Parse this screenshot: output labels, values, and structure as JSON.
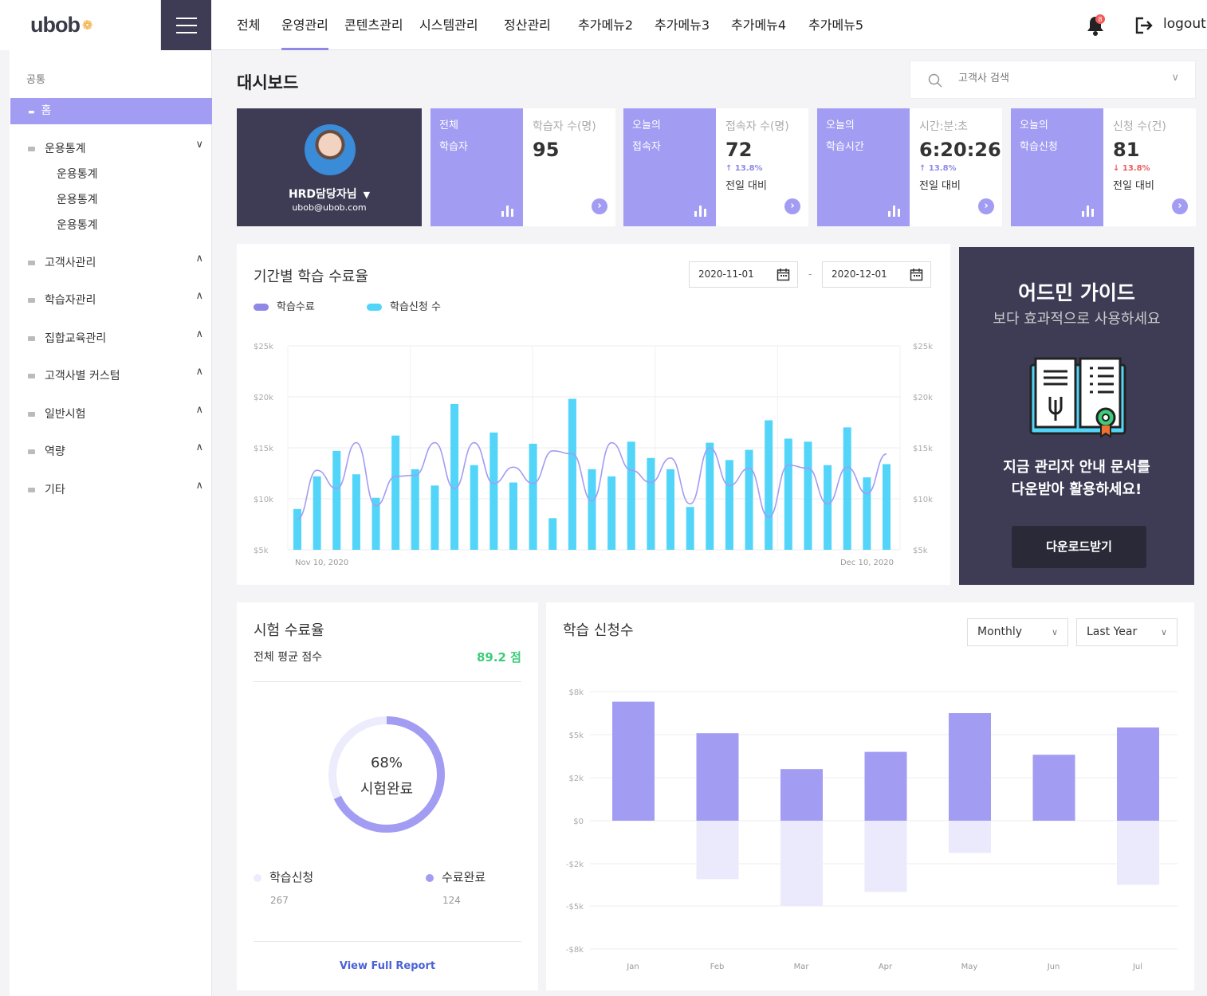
{
  "header": {
    "logo": "ubob",
    "nav": [
      "전체",
      "운영관리",
      "콘텐츠관리",
      "시스템관리",
      "정산관리",
      "추가메뉴2",
      "추가메뉴3",
      "추가메뉴4",
      "추가메뉴5"
    ],
    "active_nav": "운영관리",
    "notification_count": "8",
    "logout": "logout"
  },
  "sidebar": {
    "caption": "공통",
    "home": "홈",
    "items": [
      "운용통계",
      "고객사관리",
      "학습자관리",
      "집합교육관리",
      "고객사별 커스텀",
      "일반시험",
      "역량",
      "기타"
    ],
    "subitems": [
      "운용통계",
      "운용통계",
      "운용통계"
    ]
  },
  "page": {
    "title": "대시보드",
    "search_placeholder": "고객사 검색"
  },
  "profile": {
    "name": "HRD담당자님",
    "email": "ubob@ubob.com"
  },
  "stats": [
    {
      "line1": "전체",
      "line2": "학습자",
      "caption": "학습자 수(명)",
      "value": "95",
      "delta": "",
      "compare": ""
    },
    {
      "line1": "오늘의",
      "line2": "접속자",
      "caption": "접속자 수(명)",
      "value": "72",
      "delta": "↑ 13.8%",
      "compare": "전일 대비",
      "direction": "up"
    },
    {
      "line1": "오늘의",
      "line2": "학습시간",
      "caption": "시간:분:초",
      "value": "6:20:26",
      "delta": "↑ 13.8%",
      "compare": "전일 대비",
      "direction": "up"
    },
    {
      "line1": "오늘의",
      "line2": "학습신청",
      "caption": "신청 수(건)",
      "value": "81",
      "delta": "↓ 13.8%",
      "compare": "전일 대비",
      "direction": "down"
    }
  ],
  "line_chart": {
    "title": "기간별 학습 수료율",
    "date_from": "2020-11-01",
    "date_to": "2020-12-01",
    "date_sep": "-",
    "legend": [
      "학습수료",
      "학습신청 수"
    ]
  },
  "guide": {
    "title": "어드민 가이드",
    "subtitle": "보다 효과적으로 사용하세요",
    "text_line1": "지금 관리자 안내 문서를",
    "text_line2": "다운받아 활용하세요!",
    "button": "다운로드받기"
  },
  "exam": {
    "title": "시험 수료율",
    "avg_label": "전체 평균 점수",
    "avg_value": "89.2 점",
    "percent": "68%",
    "percent_label": "시험완료",
    "percent_value": 0.68,
    "legend": [
      {
        "label": "학습신청",
        "value": "267"
      },
      {
        "label": "수료완료",
        "value": "124"
      }
    ],
    "report_link": "View Full Report"
  },
  "bar_panel": {
    "title": "학습 신청수",
    "period": "Monthly",
    "range": "Last Year"
  },
  "colors": {
    "accent": "#a29cf3",
    "dark": "#3e3c55",
    "cyan": "#52d5f8",
    "green": "#3dcc7a",
    "up": "#8f88e6",
    "down": "#f05a5a"
  },
  "chart_data": [
    {
      "type": "bar",
      "title": "기간별 학습 수료율",
      "x_start_label": "Nov 10, 2020",
      "x_end_label": "Dec 10, 2020",
      "y_ticks": [
        "$25k",
        "$20k",
        "$15k",
        "$10k",
        "$5k"
      ],
      "ylim": [
        5000,
        25000
      ],
      "series": [
        {
          "name": "학습신청 수",
          "type": "bar",
          "values": [
            9000,
            12200,
            14700,
            12400,
            10100,
            16200,
            12900,
            11300,
            19300,
            13300,
            16500,
            11600,
            15400,
            8100,
            19800,
            12900,
            12200,
            15600,
            14000,
            12900,
            9200,
            15500,
            13800,
            14800,
            17700,
            15900,
            15600,
            13300,
            17000,
            12100,
            13400
          ]
        },
        {
          "name": "학습수료",
          "type": "line",
          "values": [
            8000,
            12800,
            11000,
            15500,
            9300,
            12200,
            12300,
            15500,
            11000,
            15500,
            11500,
            13100,
            11500,
            14700,
            14400,
            9800,
            15500,
            12800,
            11600,
            14000,
            9500,
            15000,
            11300,
            13000,
            8200,
            13300,
            13000,
            9500,
            13100,
            10500,
            14400
          ]
        }
      ]
    },
    {
      "type": "bar",
      "title": "학습 신청수",
      "categories": [
        "Jan",
        "Feb",
        "Mar",
        "Apr",
        "May",
        "Jun",
        "Jul"
      ],
      "y_ticks": [
        "$8k",
        "$5k",
        "$2k",
        "$0",
        "-$2k",
        "-$5k",
        "-$8k"
      ],
      "ylim": [
        -8,
        8
      ],
      "series": [
        {
          "values": [
            7.3,
            5.1,
            2.6,
            3.8,
            6.5,
            3.6,
            5.5
          ]
        },
        {
          "values": [
            0,
            -3.1,
            -5.0,
            -4.0,
            -1.5,
            0,
            -3.5
          ]
        }
      ]
    }
  ]
}
